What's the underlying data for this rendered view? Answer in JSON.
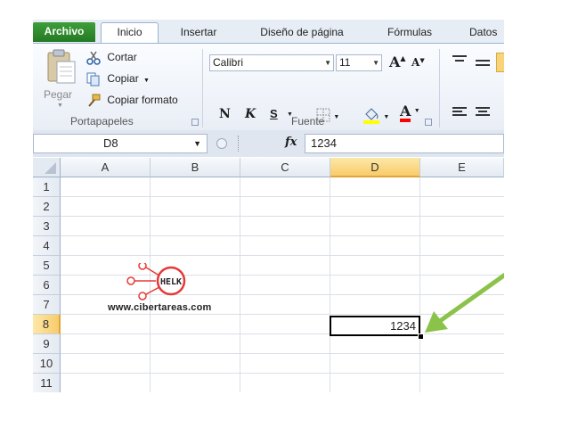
{
  "tabs": {
    "file": "Archivo",
    "home": "Inicio",
    "insert": "Insertar",
    "page_layout": "Diseño de página",
    "formulas": "Fórmulas",
    "data": "Datos"
  },
  "clipboard": {
    "paste": "Pegar",
    "cut": "Cortar",
    "copy": "Copiar",
    "format_painter": "Copiar formato",
    "group_label": "Portapapeles"
  },
  "font": {
    "family": "Calibri",
    "size": "11",
    "bold": "N",
    "italic": "K",
    "underline": "S",
    "group_label": "Fuente",
    "grow_icon": "A",
    "shrink_icon": "A",
    "fill_color": "#ffff00",
    "font_color": "#ff0000"
  },
  "formula_bar": {
    "name_box": "D8",
    "fx": "fx",
    "value": "1234"
  },
  "columns": [
    "A",
    "B",
    "C",
    "D",
    "E"
  ],
  "rows": [
    "1",
    "2",
    "3",
    "4",
    "5",
    "6",
    "7",
    "8",
    "9",
    "10",
    "11"
  ],
  "selected": {
    "column": "D",
    "row": "8",
    "value": "1234"
  },
  "watermark": {
    "logo_text": "HELK",
    "url": "www.cibertareas.com"
  },
  "colors": {
    "accent_green": "#2f8f2c",
    "arrow_green": "#8bc34a",
    "header_selected": "#f8cc6a",
    "logo_red": "#e53935"
  }
}
